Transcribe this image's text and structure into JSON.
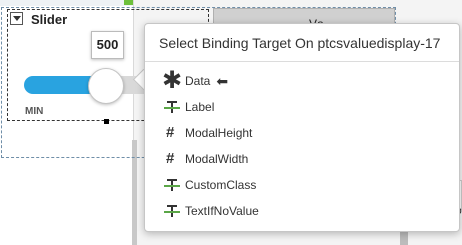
{
  "widget": {
    "title": "Slider",
    "value": "500",
    "min_label": "MIN",
    "slider_value_fraction": 0.6,
    "background_header_text": "Va",
    "right_partial_text": "ro"
  },
  "popup": {
    "title": "Select Binding Target On ptcsvaluedisplay-17",
    "items": [
      {
        "label": "Data",
        "icon": "asterisk-icon"
      },
      {
        "label": "Label",
        "icon": "string-type-icon"
      },
      {
        "label": "ModalHeight",
        "icon": "number-hash-icon"
      },
      {
        "label": "ModalWidth",
        "icon": "number-hash-icon"
      },
      {
        "label": "CustomClass",
        "icon": "string-type-icon"
      },
      {
        "label": "TextIfNoValue",
        "icon": "string-type-icon"
      }
    ]
  },
  "colors": {
    "slider_fill": "#29a3e0",
    "string_underline": "#5aa647"
  }
}
